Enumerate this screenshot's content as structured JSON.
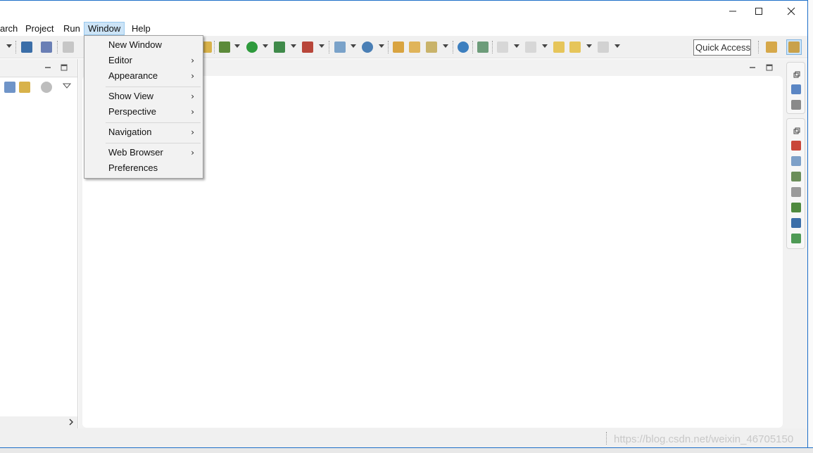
{
  "window": {
    "controls": {
      "minimize": "—",
      "maximize": "☐",
      "close": "✕"
    }
  },
  "menubar": {
    "items": [
      "arch",
      "Project",
      "Run",
      "Window",
      "Help"
    ],
    "active": "Window"
  },
  "toolbar": {
    "quick_access_placeholder": "Quick Access"
  },
  "window_menu": {
    "items": [
      {
        "label": "New Window",
        "submenu": false
      },
      {
        "label": "Editor",
        "submenu": true
      },
      {
        "label": "Appearance",
        "submenu": true
      },
      {
        "label": "Show View",
        "submenu": true
      },
      {
        "label": "Perspective",
        "submenu": true
      },
      {
        "label": "Navigation",
        "submenu": true
      },
      {
        "label": "Web Browser",
        "submenu": true
      },
      {
        "label": "Preferences",
        "submenu": false
      }
    ],
    "submenu_glyph": "›"
  },
  "statusbar": {
    "watermark": "https://blog.csdn.net/weixin_46705150"
  },
  "colors": {
    "accent_border": "#1e6fc9",
    "menu_highlight": "#cce4f7"
  }
}
